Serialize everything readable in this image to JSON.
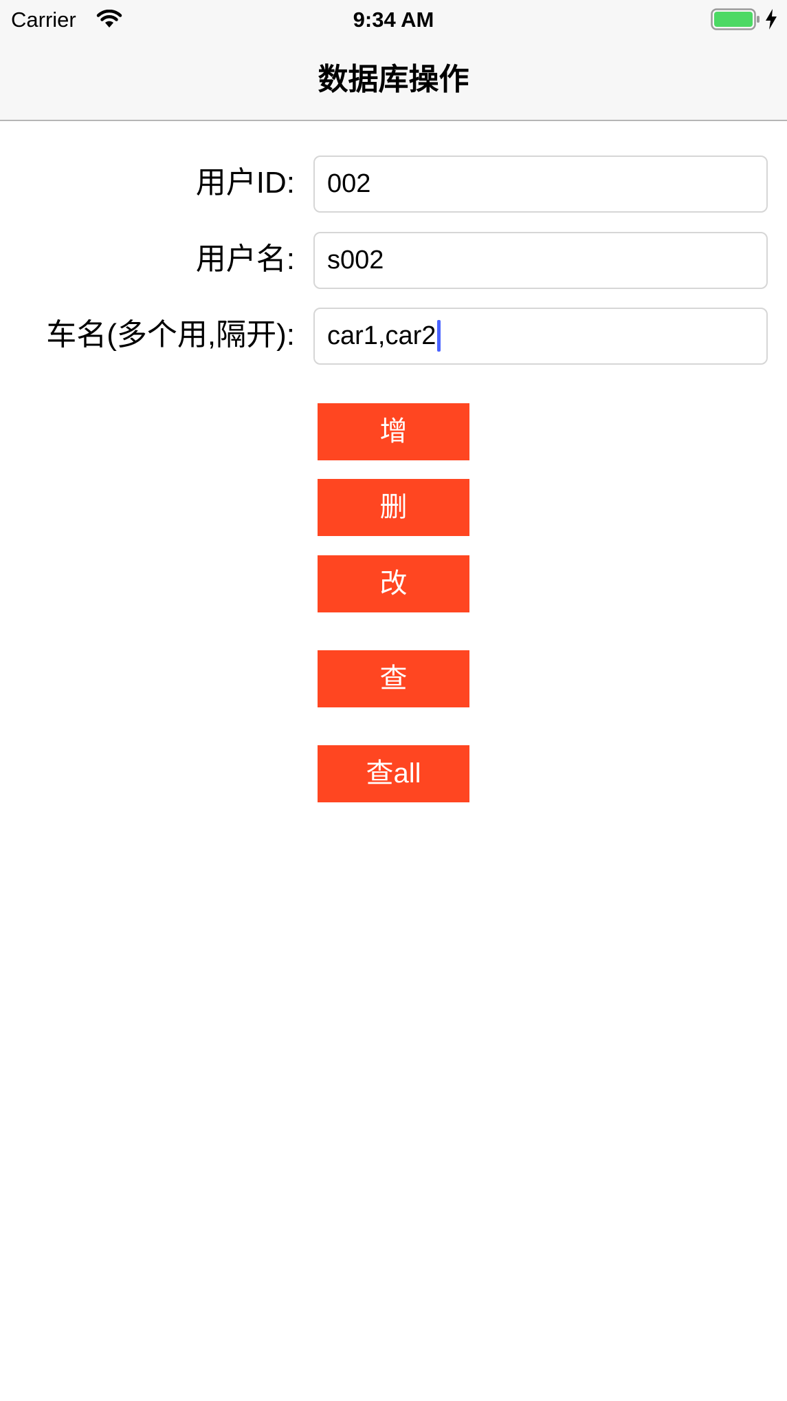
{
  "status_bar": {
    "carrier": "Carrier",
    "time": "9:34 AM",
    "wifi_icon": "wifi-icon",
    "battery_icon": "battery-icon",
    "charging_icon": "charging-bolt-icon",
    "battery_color": "#4cd964"
  },
  "nav": {
    "title": "数据库操作",
    "background": "#f7f7f7"
  },
  "form": {
    "user_id": {
      "label": "用户ID:",
      "value": "002"
    },
    "user_name": {
      "label": "用户名:",
      "value": "s002"
    },
    "car_names": {
      "label": "车名(多个用,隔开):",
      "value": "car1,car2"
    }
  },
  "actions": {
    "add_label": "增",
    "delete_label": "删",
    "update_label": "改",
    "query_label": "查",
    "query_all_label": "查all",
    "button_color": "#ff4621"
  }
}
